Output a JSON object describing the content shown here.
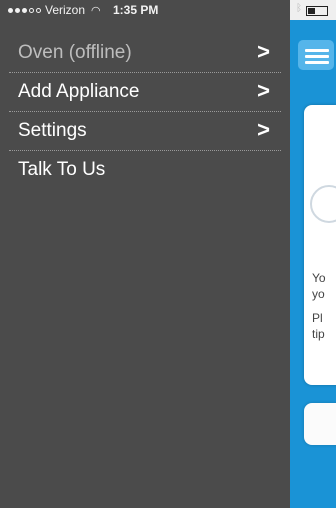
{
  "status_bar": {
    "carrier": "Verizon",
    "time": "1:35 PM"
  },
  "menu": {
    "items": [
      {
        "label": "Oven (offline)",
        "chevron": ">"
      },
      {
        "label": "Add Appliance",
        "chevron": ">"
      },
      {
        "label": "Settings",
        "chevron": ">"
      },
      {
        "label": "Talk To Us",
        "chevron": ""
      }
    ]
  },
  "background_app": {
    "card_text_lines": [
      "Yo",
      "yo",
      "Pl",
      "tip"
    ]
  },
  "colors": {
    "drawer_bg": "#4b4b4b",
    "accent": "#1a93d6",
    "offline_text": "#bdbdbd"
  }
}
